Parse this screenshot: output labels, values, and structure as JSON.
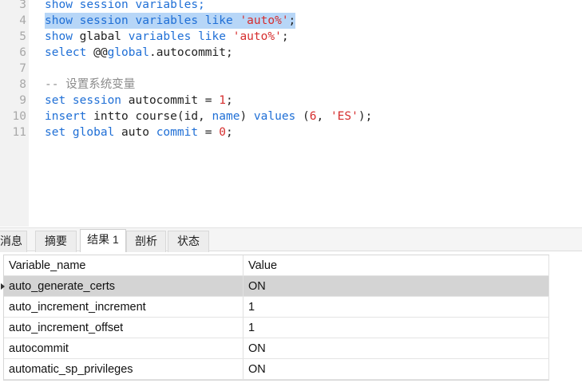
{
  "editor": {
    "lines": [
      {
        "num": "3",
        "tokens": [
          {
            "t": "show session variables;",
            "c": "kw"
          }
        ]
      },
      {
        "num": "4",
        "selected": true,
        "tokens": [
          {
            "t": "show session variables like ",
            "c": "kw"
          },
          {
            "t": "'auto%'",
            "c": "str"
          },
          {
            "t": ";",
            "c": "plain"
          }
        ]
      },
      {
        "num": "5",
        "tokens": [
          {
            "t": "show ",
            "c": "kw"
          },
          {
            "t": "glabal ",
            "c": "plain"
          },
          {
            "t": "variables like ",
            "c": "kw"
          },
          {
            "t": "'auto%'",
            "c": "str"
          },
          {
            "t": ";",
            "c": "plain"
          }
        ]
      },
      {
        "num": "6",
        "tokens": [
          {
            "t": "select ",
            "c": "kw"
          },
          {
            "t": "@@",
            "c": "plain"
          },
          {
            "t": "global",
            "c": "kw"
          },
          {
            "t": ".autocommit;",
            "c": "plain"
          }
        ]
      },
      {
        "num": "7",
        "tokens": []
      },
      {
        "num": "8",
        "tokens": [
          {
            "t": "-- 设置系统变量",
            "c": "cmt"
          }
        ]
      },
      {
        "num": "9",
        "tokens": [
          {
            "t": "set session ",
            "c": "kw"
          },
          {
            "t": "autocommit = ",
            "c": "plain"
          },
          {
            "t": "1",
            "c": "num"
          },
          {
            "t": ";",
            "c": "plain"
          }
        ]
      },
      {
        "num": "10",
        "tokens": [
          {
            "t": "insert ",
            "c": "kw"
          },
          {
            "t": "intto course(id, ",
            "c": "plain"
          },
          {
            "t": "name",
            "c": "kw"
          },
          {
            "t": ") ",
            "c": "plain"
          },
          {
            "t": "values ",
            "c": "kw"
          },
          {
            "t": "(",
            "c": "plain"
          },
          {
            "t": "6",
            "c": "num"
          },
          {
            "t": ", ",
            "c": "plain"
          },
          {
            "t": "'ES'",
            "c": "str"
          },
          {
            "t": ");",
            "c": "plain"
          }
        ]
      },
      {
        "num": "11",
        "tokens": [
          {
            "t": "set global ",
            "c": "kw"
          },
          {
            "t": "auto ",
            "c": "plain"
          },
          {
            "t": "commit ",
            "c": "kw"
          },
          {
            "t": "= ",
            "c": "plain"
          },
          {
            "t": "0",
            "c": "num"
          },
          {
            "t": ";",
            "c": "plain"
          }
        ]
      }
    ]
  },
  "tabs": [
    {
      "label": "消息"
    },
    {
      "label": "摘要"
    },
    {
      "label": "结果 1",
      "active": true
    },
    {
      "label": "剖析"
    },
    {
      "label": "状态"
    }
  ],
  "result": {
    "columns": [
      "Variable_name",
      "Value"
    ],
    "rows": [
      {
        "name": "auto_generate_certs",
        "value": "ON",
        "selected": true
      },
      {
        "name": "auto_increment_increment",
        "value": "1"
      },
      {
        "name": "auto_increment_offset",
        "value": "1"
      },
      {
        "name": "autocommit",
        "value": "ON"
      },
      {
        "name": "automatic_sp_privileges",
        "value": "ON"
      }
    ]
  }
}
